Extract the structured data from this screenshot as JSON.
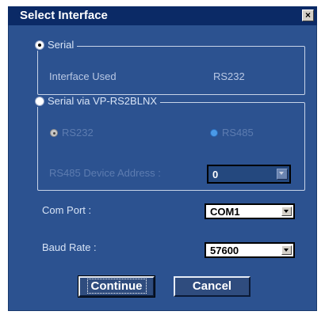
{
  "window": {
    "title": "Select Interface",
    "close_symbol": "×"
  },
  "serial_group": {
    "radio_label": "Serial",
    "selected": true,
    "interface_used_label": "Interface Used",
    "interface_used_value": "RS232"
  },
  "vp_group": {
    "radio_label": "Serial via VP-RS2BLNX",
    "selected": false,
    "rs232_label": "RS232",
    "rs485_label": "RS485",
    "device_address_label": "RS485 Device Address :",
    "device_address_value": "0"
  },
  "com_port": {
    "label": "Com Port :",
    "value": "COM1"
  },
  "baud_rate": {
    "label": "Baud Rate :",
    "value": "57600"
  },
  "buttons": {
    "continue": "Continue",
    "cancel": "Cancel"
  },
  "colors": {
    "dialog_bg": "#2c5290",
    "titlebar_bg": "#0b2a66"
  }
}
